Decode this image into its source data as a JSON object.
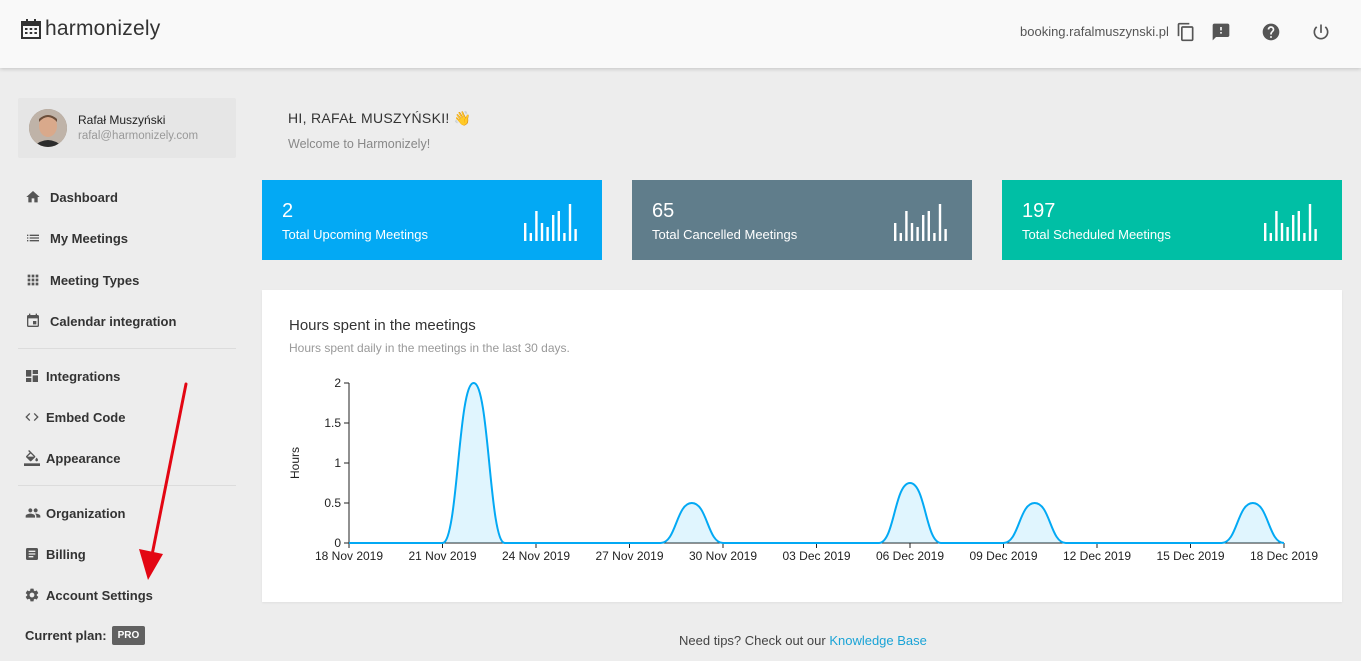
{
  "app": {
    "name": "harmonizely"
  },
  "topbar": {
    "booking_url": "booking.rafalmuszynski.pl",
    "icons": [
      "copy-icon",
      "feedback-icon",
      "help-icon",
      "power-icon"
    ]
  },
  "profile": {
    "name": "Rafał Muszyński",
    "email": "rafal@harmonizely.com"
  },
  "sidebar": {
    "items": [
      {
        "label": "Dashboard",
        "icon": "home-icon"
      },
      {
        "label": "My Meetings",
        "icon": "list-icon"
      },
      {
        "label": "Meeting Types",
        "icon": "grid-icon"
      },
      {
        "label": "Calendar integration",
        "icon": "calendar-icon"
      },
      {
        "label": "Integrations",
        "icon": "dashboard-icon"
      },
      {
        "label": "Embed Code",
        "icon": "code-icon"
      },
      {
        "label": "Appearance",
        "icon": "paint-bucket-icon"
      },
      {
        "label": "Organization",
        "icon": "people-icon"
      },
      {
        "label": "Billing",
        "icon": "receipt-icon"
      },
      {
        "label": "Account Settings",
        "icon": "gear-icon"
      }
    ],
    "plan_label": "Current plan:",
    "plan_badge": "PRO"
  },
  "main": {
    "greeting": "HI, RAFAŁ MUSZYŃSKI! 👋",
    "welcome": "Welcome to Harmonizely!"
  },
  "stats": [
    {
      "value": "2",
      "label": "Total Upcoming Meetings",
      "color": "#03a9f4"
    },
    {
      "value": "65",
      "label": "Total Cancelled Meetings",
      "color": "#607d8b"
    },
    {
      "value": "197",
      "label": "Total Scheduled Meetings",
      "color": "#00bfa5"
    }
  ],
  "chart_data": {
    "type": "area",
    "title": "Hours spent in the meetings",
    "subtitle": "Hours spent daily in the meetings in the last 30 days.",
    "ylabel": "Hours",
    "xlabel": "",
    "ylim": [
      0,
      2
    ],
    "yticks": [
      "0",
      "0.5",
      "1",
      "1.5",
      "2"
    ],
    "xticks": [
      "18 Nov 2019",
      "21 Nov 2019",
      "24 Nov 2019",
      "27 Nov 2019",
      "30 Nov 2019",
      "03 Dec 2019",
      "06 Dec 2019",
      "09 Dec 2019",
      "12 Dec 2019",
      "15 Dec 2019",
      "18 Dec 2019"
    ],
    "x": [
      "18 Nov 2019",
      "19 Nov 2019",
      "20 Nov 2019",
      "21 Nov 2019",
      "22 Nov 2019",
      "23 Nov 2019",
      "24 Nov 2019",
      "25 Nov 2019",
      "26 Nov 2019",
      "27 Nov 2019",
      "28 Nov 2019",
      "29 Nov 2019",
      "30 Nov 2019",
      "01 Dec 2019",
      "02 Dec 2019",
      "03 Dec 2019",
      "04 Dec 2019",
      "05 Dec 2019",
      "06 Dec 2019",
      "07 Dec 2019",
      "08 Dec 2019",
      "09 Dec 2019",
      "10 Dec 2019",
      "11 Dec 2019",
      "12 Dec 2019",
      "13 Dec 2019",
      "14 Dec 2019",
      "15 Dec 2019",
      "16 Dec 2019",
      "17 Dec 2019",
      "18 Dec 2019"
    ],
    "values": [
      0,
      0,
      0,
      0,
      2,
      0,
      0,
      0,
      0,
      0,
      0,
      0.5,
      0,
      0,
      0,
      0,
      0,
      0,
      0.75,
      0,
      0,
      0,
      0.5,
      0,
      0,
      0,
      0,
      0,
      0,
      0.5,
      0
    ],
    "color": "#03a9f4",
    "grid": false
  },
  "footer": {
    "text": "Need tips? Check out our ",
    "link": "Knowledge Base"
  }
}
